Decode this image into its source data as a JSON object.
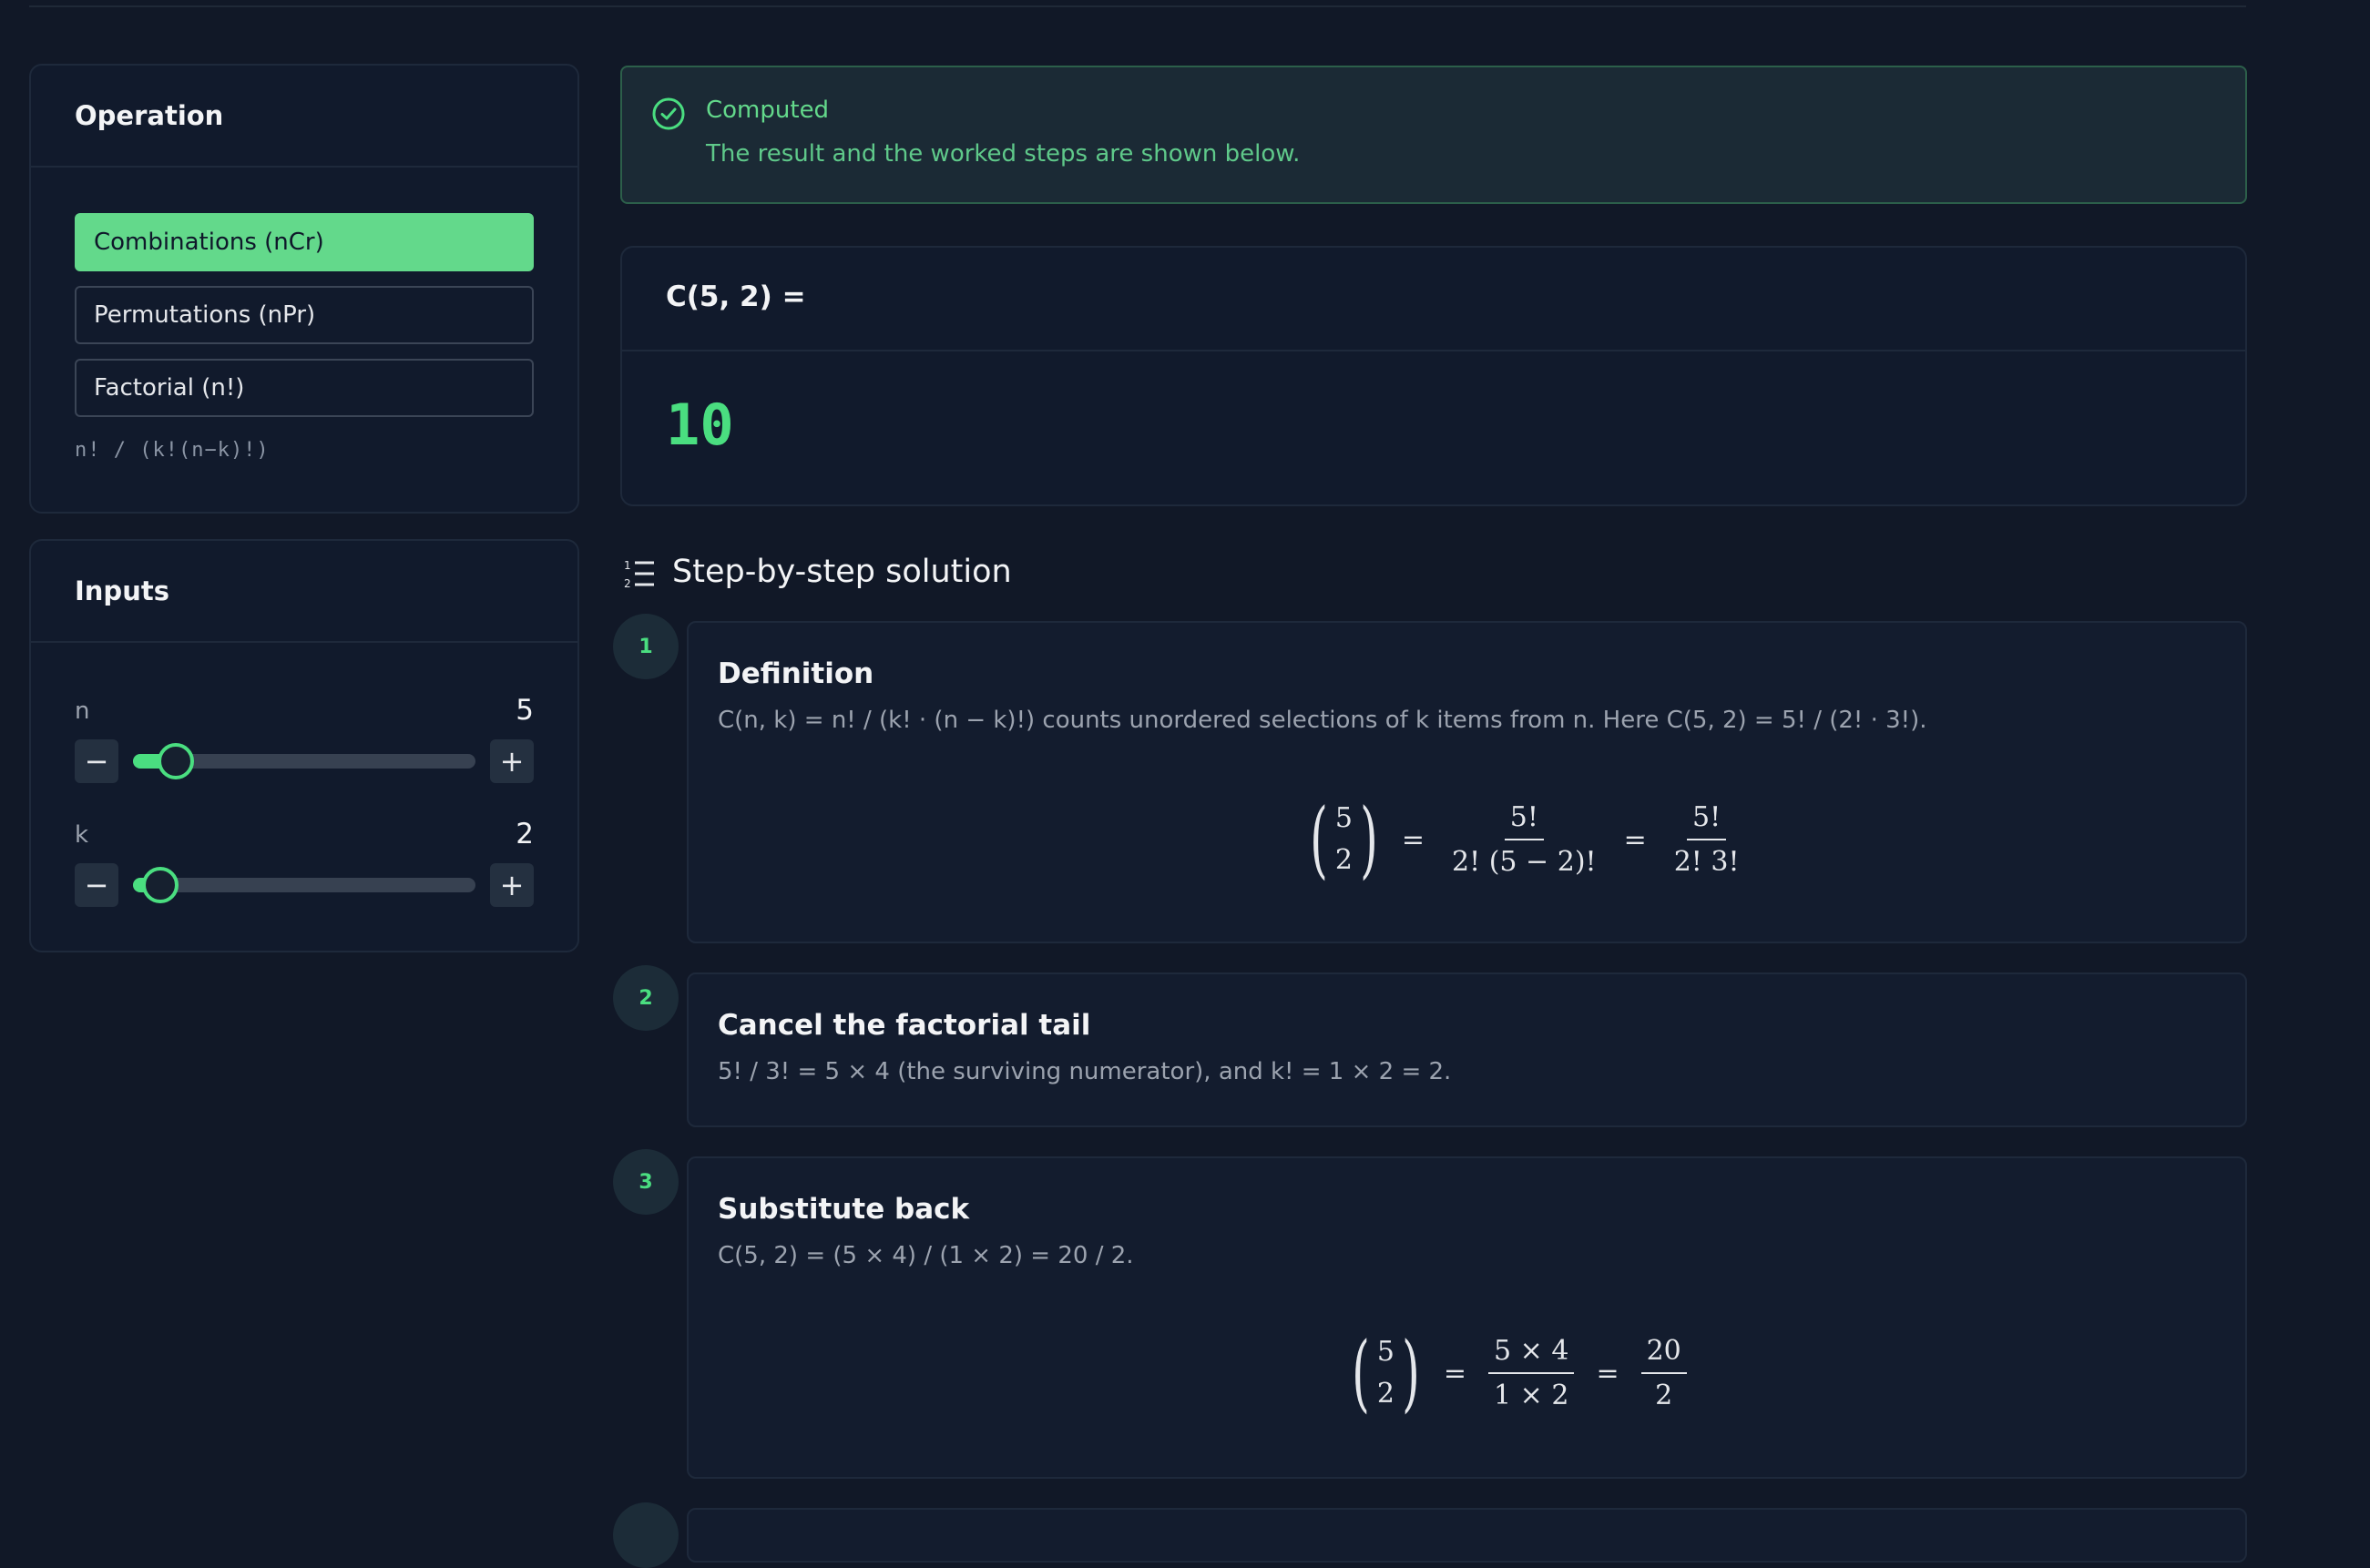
{
  "operation": {
    "title": "Operation",
    "options": [
      "Combinations (nCr)",
      "Permutations (nPr)",
      "Factorial (n!)"
    ],
    "selected": "Combinations (nCr)",
    "formula": "n! / (k!(n−k)!)"
  },
  "inputs": {
    "title": "Inputs",
    "n": {
      "label": "n",
      "value": "5",
      "level": 0.125
    },
    "k": {
      "label": "k",
      "value": "2",
      "level": 0.08
    },
    "minus_label": "−",
    "plus_label": "+"
  },
  "alert": {
    "title": "Computed",
    "description": "The result and the worked steps are shown below."
  },
  "result": {
    "label": "C(5, 2) =",
    "value": "10"
  },
  "solution": {
    "title": "Step-by-step solution",
    "steps": [
      {
        "number": "1",
        "title": "Definition",
        "description": "C(n, k) = n! / (k! · (n − k)!) counts unordered selections of k items from n. Here C(5, 2) = 5! / (2! · 3!).",
        "math": {
          "top": "5",
          "bottom": "2",
          "f1_num": "5!",
          "f1_den": "2! (5 − 2)!",
          "f2_num": "5!",
          "f2_den": "2! 3!"
        }
      },
      {
        "number": "2",
        "title": "Cancel the factorial tail",
        "description": "5! / 3! = 5 × 4 (the surviving numerator), and k! = 1 × 2 = 2."
      },
      {
        "number": "3",
        "title": "Substitute back",
        "description": "C(5, 2) = (5 × 4) / (1 × 2) = 20 / 2.",
        "math": {
          "top": "5",
          "bottom": "2",
          "f1_num": "5 × 4",
          "f1_den": "1 × 2",
          "f2_num": "20",
          "f2_den": "2"
        }
      }
    ]
  },
  "colors": {
    "accent": "#4ade80",
    "background": "#111827",
    "card": "#111a2c"
  }
}
